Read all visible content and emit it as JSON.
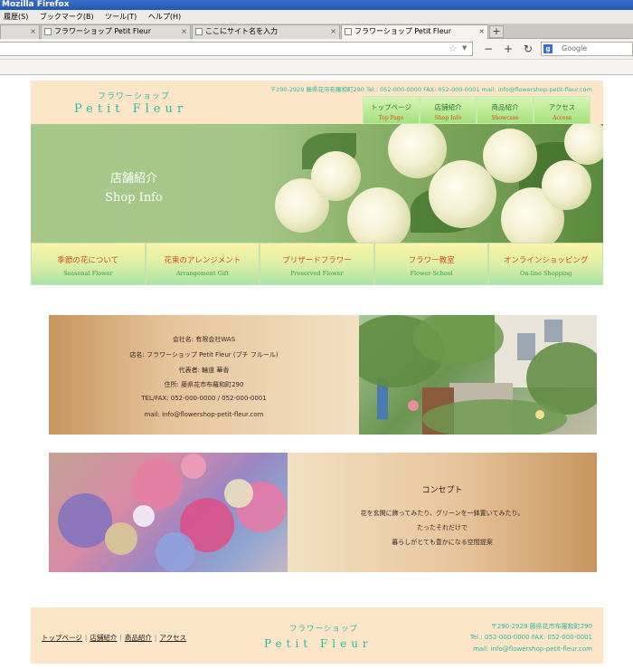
{
  "browser": {
    "title": "Mozilla Firefox",
    "menu": [
      "履歴(S)",
      "ブックマーク(B)",
      "ツール(T)",
      "ヘルプ(H)"
    ],
    "tabs": [
      {
        "label": "",
        "active": false
      },
      {
        "label": "フラワーショップ Petit Fleur",
        "active": false
      },
      {
        "label": "ここにサイト名を入力",
        "active": false
      },
      {
        "label": "フラワーショップ Petit Fleur",
        "active": true
      }
    ],
    "new_tab": "+",
    "search_placeholder": "Google"
  },
  "header": {
    "logo_sub": "フラワーショップ",
    "logo_main": "Petit Fleur",
    "contact": "〒290-2929 藤県花市布羅和町290 Tel.: 052-000-0000 FAX: 052-000-0001  mail: info@flowershop-petit-fleur.com",
    "nav": [
      {
        "jp": "トップページ",
        "en": "Top Page"
      },
      {
        "jp": "店舗紹介",
        "en": "Shop Info"
      },
      {
        "jp": "商品紹介",
        "en": "Showcase"
      },
      {
        "jp": "アクセス",
        "en": "Access"
      }
    ]
  },
  "hero": {
    "title_jp": "店舗紹介",
    "title_en": "Shop Info"
  },
  "subnav": [
    {
      "jp": "季節の花について",
      "en": "Seasonal Flower"
    },
    {
      "jp": "花束のアレンジメント",
      "en": "Arrangement Gift"
    },
    {
      "jp": "プリザードフラワー",
      "en": "Preserved Flower"
    },
    {
      "jp": "フラワー教室",
      "en": "Flower School"
    },
    {
      "jp": "オンラインショッピング",
      "en": "On-line Shopping"
    }
  ],
  "info": {
    "lines": [
      "会社名: 有限会社WAS",
      "店名: フラワーショップ Petit Fleur (プチ フルール)",
      "代表者: 輪道 華香",
      "住所: 藤県花市布羅和町290",
      "TEL/FAX: 052-000-0000 / 052-000-0001",
      "mail: info@flowershop-petit-fleur.com"
    ]
  },
  "concept": {
    "title": "コンセプト",
    "lines": [
      "花を玄関に飾ってみたり、グリーンを一鉢置いてみたり。",
      "たったそれだけで",
      "暮らしがとても豊かになる空間提案"
    ]
  },
  "footer": {
    "nav": [
      "トップページ",
      "店舗紹介",
      "商品紹介",
      "アクセス"
    ],
    "logo_sub": "フラワーショップ",
    "logo_main": "Petit Fleur",
    "contact": [
      "〒290-2929 藤県花市布羅和町290",
      "Tel.: 052-000-0000 FAX: 052-000-0001",
      "mail: info@flowershop-petit-fleur.com"
    ]
  }
}
